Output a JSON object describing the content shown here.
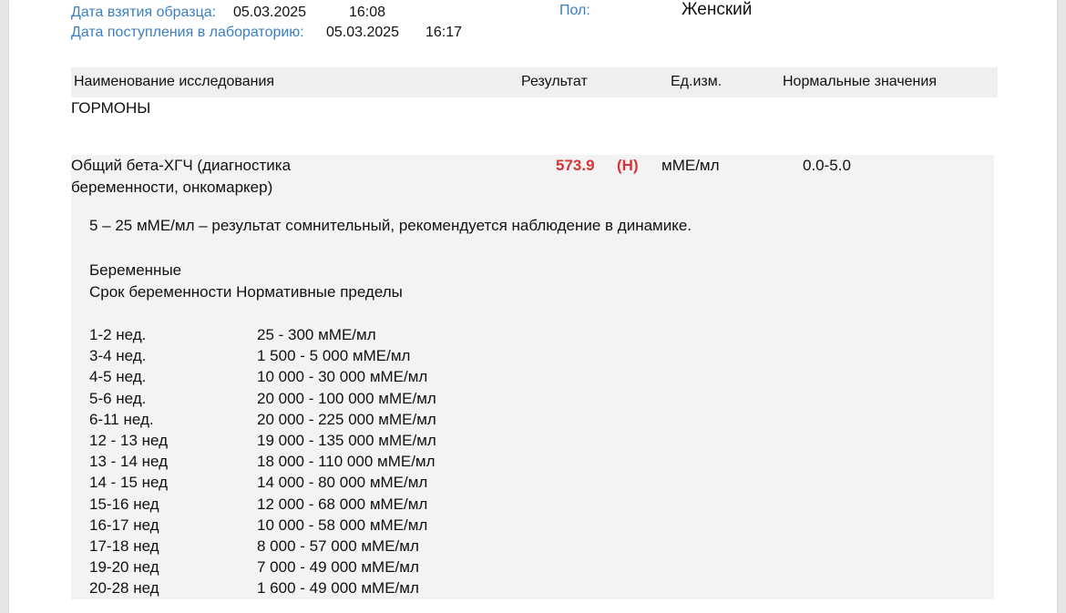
{
  "header": {
    "sample_date_label": "Дата взятия образца:",
    "sample_date": "05.03.2025",
    "sample_time": "16:08",
    "lab_date_label": "Дата поступления в лабораторию:",
    "lab_date": "05.03.2025",
    "lab_time": "16:17",
    "sex_label": "Пол:",
    "sex_value": "Женский"
  },
  "table": {
    "columns": [
      "Наименование исследования",
      "Результат",
      "Ед.изм.",
      "Нормальные значения"
    ]
  },
  "section": {
    "title": "ГОРМОНЫ"
  },
  "test": {
    "name": "Общий бета-ХГЧ (диагностика беременности, онкомаркер)",
    "result": "573.9",
    "flag": "(Н)",
    "unit": "мМЕ/мл",
    "normal": "0.0-5.0",
    "note": "5 – 25 мМЕ/мл – результат сомнительный, рекомендуется наблюдение в динамике.",
    "pregnant_title": "Беременные",
    "pregnant_header": "Срок беременности  Нормативные пределы",
    "ranges": [
      {
        "term": "1-2 нед.",
        "value": "25 - 300 мМЕ/мл"
      },
      {
        "term": "3-4 нед.",
        "value": "1 500 - 5 000 мМЕ/мл"
      },
      {
        "term": "4-5 нед.",
        "value": "10 000 - 30 000 мМЕ/мл"
      },
      {
        "term": "5-6 нед.",
        "value": "20 000 - 100 000 мМЕ/мл"
      },
      {
        "term": "6-11 нед.",
        "value": "20 000 - 225 000 мМЕ/мл"
      },
      {
        "term": "12 - 13 нед",
        "value": "19 000 - 135 000 мМЕ/мл"
      },
      {
        "term": "13 - 14 нед",
        "value": "18 000 - 110 000 мМЕ/мл"
      },
      {
        "term": "14 - 15 нед",
        "value": "14 000 - 80 000 мМЕ/мл"
      },
      {
        "term": "15-16 нед",
        "value": "12 000 - 68 000 мМЕ/мл"
      },
      {
        "term": "16-17 нед",
        "value": "10 000 - 58 000 мМЕ/мл"
      },
      {
        "term": "17-18 нед",
        "value": "8 000 - 57 000 мМЕ/мл"
      },
      {
        "term": "19-20 нед",
        "value": "7 000 - 49 000 мМЕ/мл"
      },
      {
        "term": "20-28 нед",
        "value": "1 600 - 49 000 мМЕ/мл"
      }
    ]
  }
}
